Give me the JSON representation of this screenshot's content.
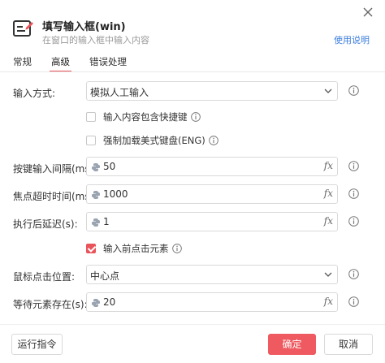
{
  "header": {
    "title": "填写输入框(win)",
    "subtitle": "在窗口的输入框中输入内容",
    "help_link": "使用说明",
    "app_icon": "form-edit-icon",
    "close_icon": "close-icon"
  },
  "tabs": [
    {
      "label": "常规",
      "active": false
    },
    {
      "label": "高级",
      "active": true
    },
    {
      "label": "错误处理",
      "active": false
    }
  ],
  "form": {
    "input_method": {
      "label": "输入方式:",
      "value": "模拟人工输入"
    },
    "include_shortcut": {
      "label": "输入内容包含快捷键",
      "checked": false
    },
    "force_us_keyboard": {
      "label": "强制加载美式键盘(ENG)",
      "checked": false
    },
    "key_interval": {
      "label": "按键输入间隔(ms):",
      "value": "50"
    },
    "focus_timeout": {
      "label": "焦点超时时间(ms):",
      "value": "1000"
    },
    "post_delay": {
      "label": "执行后延迟(s):",
      "value": "1"
    },
    "click_before_input": {
      "label": "输入前点击元素",
      "checked": true
    },
    "click_position": {
      "label": "鼠标点击位置:",
      "value": "中心点"
    },
    "wait_element": {
      "label": "等待元素存在(s):",
      "value": "20"
    },
    "fx_label": "fx"
  },
  "footer": {
    "run_label": "运行指令",
    "ok_label": "确定",
    "cancel_label": "取消"
  },
  "colors": {
    "accent": "#ee5a60",
    "link": "#3b7ddd"
  }
}
